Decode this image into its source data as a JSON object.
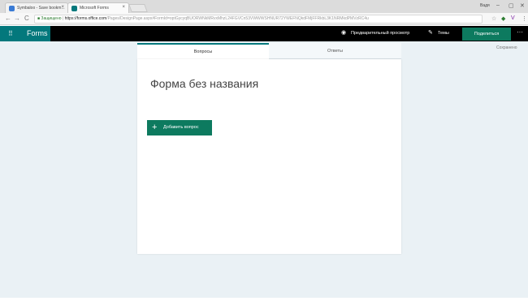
{
  "browser": {
    "tabs": [
      {
        "title": "Symbaloo - Save bookm...",
        "favicon_color": "#3a7bd5"
      },
      {
        "title": "Microsoft Forms",
        "favicon_color": "#03787c"
      }
    ],
    "user": "Вадя",
    "window_controls": {
      "minimize": "–",
      "maximize": "▢",
      "close": "✕"
    },
    "nav": {
      "back": "←",
      "forward": "→",
      "reload": "C"
    },
    "address": {
      "secure_label": "Защищено",
      "url_host": "https://forms.office.com",
      "url_path": "/Pages/DesignPage.aspx#FormId=optGycyqBUORWNkMRvxMhzL24FGVCn53VWWWSHNUR72YWEFNQkdFMjFFRkbL3K1NRMkdPMVzRC4u"
    },
    "extensions": {
      "star": "☆",
      "ext1": "◆",
      "ext2": "V",
      "menu": "⋮"
    }
  },
  "app": {
    "waffle_icon": "⠿",
    "brand": "Forms",
    "preview_icon": "◉",
    "preview_label": "Предварительный просмотр",
    "themes_icon": "✎",
    "themes_label": "Темы",
    "share_label": "Поделиться",
    "more_icon": "···",
    "accent": "#03787c",
    "button_color": "#0d7a5f"
  },
  "editor": {
    "saved_status": "Сохранено",
    "tabs": [
      {
        "label": "Вопросы",
        "active": true
      },
      {
        "label": "Ответы",
        "active": false
      }
    ],
    "form_title": "Форма без названия",
    "add_question": {
      "icon": "+",
      "label": "Добавить вопрос"
    }
  }
}
